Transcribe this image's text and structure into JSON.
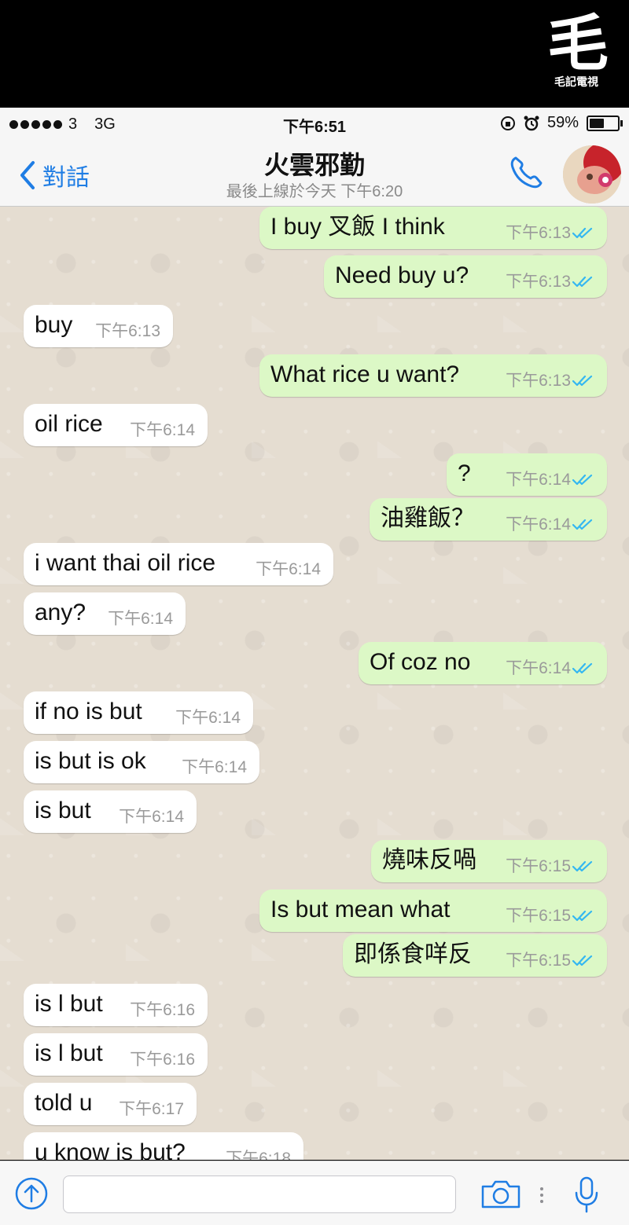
{
  "banner": {
    "logo_glyph": "毛",
    "logo_text": "毛記電視"
  },
  "status_bar": {
    "carrier": "3",
    "network": "3G",
    "time": "下午6:51",
    "battery": "59%",
    "battery_level": 0.59
  },
  "header": {
    "back_label": "對話",
    "contact_name": "火雲邪勤",
    "last_seen": "最後上線於今天 下午6:20"
  },
  "messages": [
    {
      "text": "I buy 叉飯 I think",
      "time": "下午6:13",
      "dir": "out"
    },
    {
      "text": "Need buy u?",
      "time": "下午6:13",
      "dir": "out"
    },
    {
      "text": "buy",
      "time": "下午6:13",
      "dir": "in"
    },
    {
      "text": "What rice u want?",
      "time": "下午6:13",
      "dir": "out"
    },
    {
      "text": "oil rice",
      "time": "下午6:14",
      "dir": "in"
    },
    {
      "text": "?",
      "time": "下午6:14",
      "dir": "out"
    },
    {
      "text": "油雞飯？",
      "time": "下午6:14",
      "dir": "out"
    },
    {
      "text": "i want thai oil rice",
      "time": "下午6:14",
      "dir": "in"
    },
    {
      "text": "any?",
      "time": "下午6:14",
      "dir": "in"
    },
    {
      "text": "Of coz no",
      "time": "下午6:14",
      "dir": "out"
    },
    {
      "text": "if no is but",
      "time": "下午6:14",
      "dir": "in"
    },
    {
      "text": "is but is ok",
      "time": "下午6:14",
      "dir": "in"
    },
    {
      "text": "is but",
      "time": "下午6:14",
      "dir": "in"
    },
    {
      "text": "燒味反喎",
      "time": "下午6:15",
      "dir": "out"
    },
    {
      "text": "Is but mean what",
      "time": "下午6:15",
      "dir": "out"
    },
    {
      "text": "即係食咩反",
      "time": "下午6:15",
      "dir": "out"
    },
    {
      "text": "is l but",
      "time": "下午6:16",
      "dir": "in"
    },
    {
      "text": "is l but",
      "time": "下午6:16",
      "dir": "in"
    },
    {
      "text": "told u",
      "time": "下午6:17",
      "dir": "in"
    },
    {
      "text": "u know is but?",
      "time": "下午6:18",
      "dir": "in"
    }
  ],
  "input": {
    "placeholder": ""
  },
  "icons": {
    "back": "chevron-left-icon",
    "call": "phone-icon",
    "share": "upload-arrow-icon",
    "camera": "camera-icon",
    "mic": "microphone-icon"
  },
  "colors": {
    "accent": "#1f7de4",
    "outgoing_bubble": "#dcf8c6",
    "incoming_bubble": "#ffffff",
    "read_ticks": "#34b7f1"
  }
}
